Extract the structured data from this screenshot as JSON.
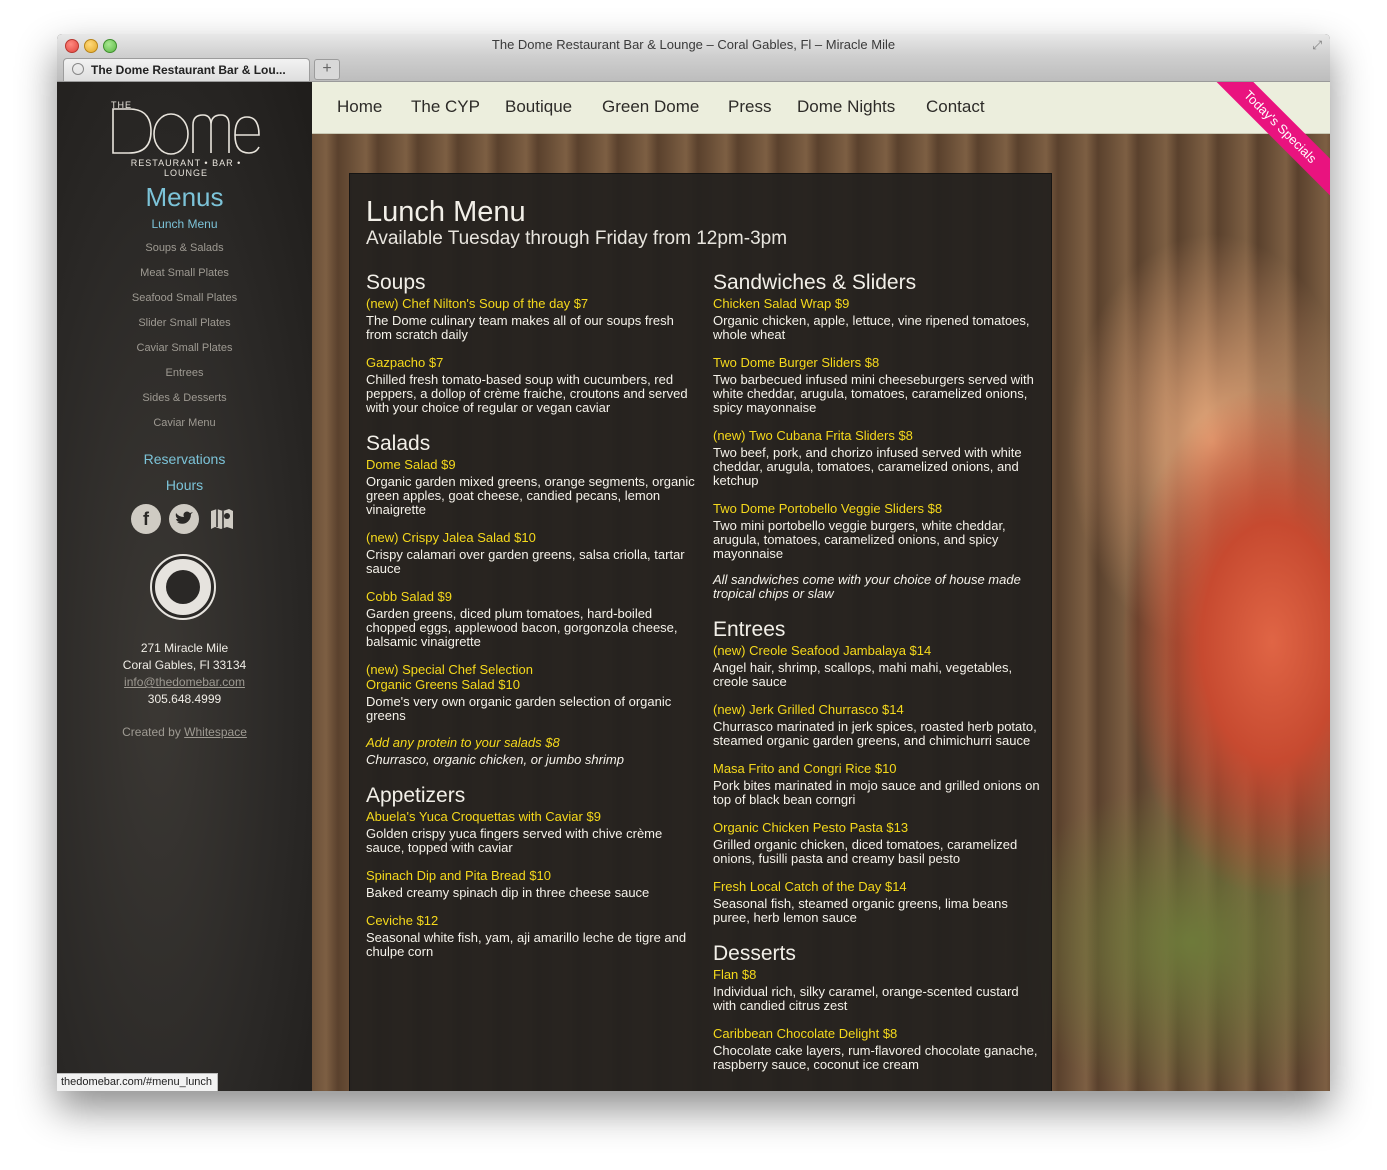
{
  "window": {
    "title": "The Dome Restaurant Bar & Lounge – Coral Gables, Fl – Miracle Mile"
  },
  "tab": {
    "label": "The Dome Restaurant Bar & Lou..."
  },
  "status_url": "thedomebar.com/#menu_lunch",
  "logo": {
    "the": "THE",
    "name": "DOME",
    "tagline": "RESTAURANT • BAR • LOUNGE"
  },
  "sidebar": {
    "heading": "Menus",
    "links": [
      "Lunch Menu",
      "Soups & Salads",
      "Meat Small Plates",
      "Seafood Small Plates",
      "Slider Small Plates",
      "Caviar Small Plates",
      "Entrees",
      "Sides & Desserts",
      "Caviar Menu"
    ],
    "reservations": "Reservations",
    "hours": "Hours",
    "address_line1": "271 Miracle Mile",
    "address_line2": "Coral Gables, Fl 33134",
    "email": "info@thedomebar.com",
    "phone": "305.648.4999",
    "created_by": "Created by",
    "creator": "Whitespace"
  },
  "nav": [
    "Home",
    "The CYP",
    "Boutique",
    "Green Dome",
    "Press",
    "Dome Nights",
    "Contact"
  ],
  "ribbon": "Today's Specials",
  "menu": {
    "title": "Lunch Menu",
    "subtitle": "Available Tuesday through Friday from 12pm-3pm",
    "left": {
      "soups": {
        "title": "Soups",
        "items": [
          {
            "name": "(new) Chef Nilton's Soup of the day $7",
            "desc": "The Dome culinary team makes all of our soups fresh from scratch daily"
          },
          {
            "name": "Gazpacho $7",
            "desc": "Chilled fresh tomato-based soup with cucumbers, red peppers, a dollop of crème fraiche, croutons and served with your choice of regular or vegan caviar"
          }
        ]
      },
      "salads": {
        "title": "Salads",
        "items": [
          {
            "name": "Dome Salad $9",
            "desc": "Organic garden mixed greens, orange segments, organic green apples, goat cheese, candied pecans, lemon vinaigrette"
          },
          {
            "name": "(new) Crispy Jalea Salad $10",
            "desc": "Crispy calamari over garden greens, salsa criolla, tartar sauce"
          },
          {
            "name": "Cobb Salad $9",
            "desc": "Garden greens, diced plum tomatoes, hard-boiled chopped eggs, applewood bacon, gorgonzola cheese, balsamic vinaigrette"
          },
          {
            "name": "(new) Special Chef Selection",
            "name2": "Organic Greens Salad $10",
            "desc": "Dome's very own organic garden selection of organic greens"
          }
        ],
        "protein_note": "Add any protein to your salads $8",
        "protein_options": "Churrasco, organic chicken, or jumbo shrimp"
      },
      "appetizers": {
        "title": "Appetizers",
        "items": [
          {
            "name": "Abuela's Yuca Croquettas with Caviar $9",
            "desc": "Golden crispy yuca fingers served with chive crème sauce, topped with caviar"
          },
          {
            "name": "Spinach Dip and Pita Bread $10",
            "desc": "Baked creamy spinach dip in three cheese sauce"
          },
          {
            "name": "Ceviche $12",
            "desc": "Seasonal white fish, yam, aji amarillo leche de tigre and chulpe corn"
          }
        ]
      }
    },
    "right": {
      "sandwiches": {
        "title": "Sandwiches & Sliders",
        "items": [
          {
            "name": "Chicken Salad Wrap $9",
            "desc": "Organic chicken, apple, lettuce, vine ripened tomatoes, whole wheat"
          },
          {
            "name": "Two Dome Burger Sliders $8",
            "desc": "Two barbecued infused mini cheeseburgers served with white cheddar, arugula, tomatoes, caramelized onions, spicy mayonnaise"
          },
          {
            "name": "(new) Two Cubana Frita Sliders $8",
            "desc": "Two beef, pork, and chorizo infused served with white cheddar, arugula, tomatoes, caramelized onions, and ketchup"
          },
          {
            "name": "Two Dome Portobello Veggie Sliders $8",
            "desc": "Two mini portobello veggie burgers, white cheddar, arugula, tomatoes, caramelized onions, and spicy mayonnaise"
          }
        ],
        "note": "All sandwiches come with your choice of house made tropical chips or slaw"
      },
      "entrees": {
        "title": "Entrees",
        "items": [
          {
            "name": "(new) Creole Seafood Jambalaya $14",
            "desc": "Angel hair, shrimp, scallops, mahi mahi, vegetables, creole sauce"
          },
          {
            "name": "(new) Jerk Grilled Churrasco $14",
            "desc": "Churrasco marinated in jerk spices, roasted herb potato, steamed organic garden greens, and chimichurri sauce"
          },
          {
            "name": "Masa Frito and Congri Rice $10",
            "desc": "Pork bites marinated in mojo sauce and grilled onions on top of black bean corngri"
          },
          {
            "name": "Organic Chicken Pesto Pasta $13",
            "desc": "Grilled organic chicken, diced tomatoes, caramelized onions, fusilli pasta and creamy basil pesto"
          },
          {
            "name": "Fresh Local Catch of the Day $14",
            "desc": "Seasonal fish, steamed organic greens, lima beans puree, herb lemon sauce"
          }
        ]
      },
      "desserts": {
        "title": "Desserts",
        "items": [
          {
            "name": "Flan $8",
            "desc": "Individual rich, silky caramel, orange-scented custard with candied citrus zest"
          },
          {
            "name": "Caribbean Chocolate Delight $8",
            "desc": "Chocolate cake layers, rum-flavored chocolate ganache, raspberry sauce, coconut ice cream"
          }
        ]
      }
    }
  },
  "colors": {
    "accent_blue": "#7cc3d8",
    "item_yellow": "#f5d91c",
    "ribbon_pink": "#e9137f",
    "nav_bg": "#eceedd"
  }
}
